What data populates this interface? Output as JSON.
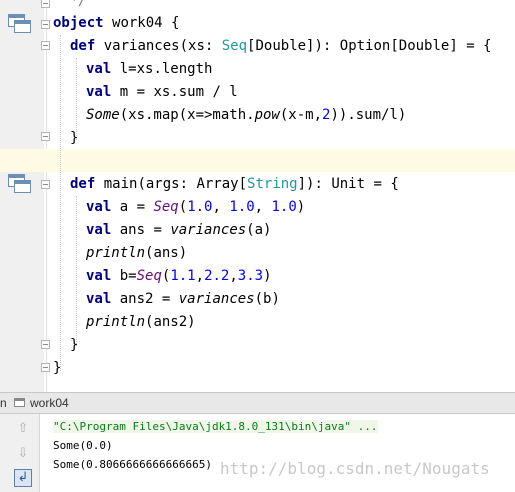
{
  "editor": {
    "comment_tail": "*/",
    "line_object": [
      "object",
      "work04 {"
    ],
    "line_def1": [
      "def",
      "variances(xs: ",
      "Seq",
      "[Double]): Option[Double] = {"
    ],
    "line_l": [
      "val",
      "l=xs.length"
    ],
    "line_m": [
      "val",
      "m = xs.sum / l"
    ],
    "line_some": [
      "Some",
      "(xs.map(x=>math.",
      "pow",
      "(x-m,",
      "2",
      ")).sum/l)"
    ],
    "close_inner": "}",
    "line_def2": [
      "def",
      "main(args: Array[",
      "String",
      "]): Unit = {"
    ],
    "line_a": [
      "val",
      "a = ",
      "Seq",
      "(",
      "1.0",
      ", ",
      "1.0",
      ", ",
      "1.0",
      ")"
    ],
    "line_ans": [
      "val",
      "ans = ",
      "variances",
      "(a)"
    ],
    "line_print1": [
      "println",
      "(ans)"
    ],
    "line_b": [
      "val",
      "b=",
      "Seq",
      "(",
      "1.1",
      ",",
      "2.2",
      ",",
      "3.3",
      ")"
    ],
    "line_ans2": [
      "val",
      "ans2 = ",
      "variances",
      "(b)"
    ],
    "line_print2": [
      "println",
      "(ans2)"
    ],
    "close_main": "}",
    "close_obj": "}"
  },
  "run_panel": {
    "header_label": "n",
    "tab_title": "work04",
    "tools": [
      "up-arrow-icon",
      "down-arrow-icon",
      "soft-wrap-icon"
    ],
    "console_lines": [
      "\"C:\\Program Files\\Java\\jdk1.8.0_131\\bin\\java\" ...",
      "Some(0.0)",
      "Some(0.8066666666666665)"
    ]
  },
  "watermark": "http://blog.csdn.net/Nougats"
}
